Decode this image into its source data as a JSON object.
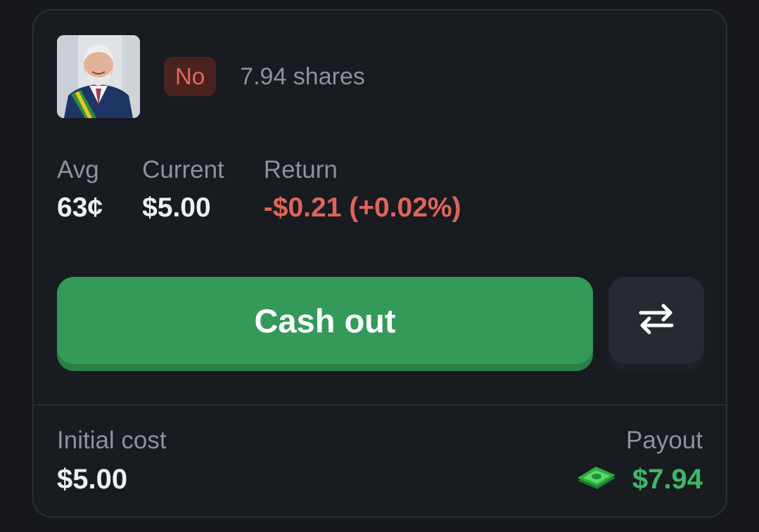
{
  "position": {
    "avatar_alt": "politician portrait",
    "side": "No",
    "shares": "7.94 shares"
  },
  "stats": {
    "avg_label": "Avg",
    "avg_value": "63¢",
    "current_label": "Current",
    "current_value": "$5.00",
    "return_label": "Return",
    "return_value": "-$0.21 (+0.02%)"
  },
  "actions": {
    "cashout_label": "Cash out",
    "swap_icon": "swap-arrows-icon"
  },
  "footer": {
    "initial_cost_label": "Initial cost",
    "initial_cost_value": "$5.00",
    "payout_label": "Payout",
    "payout_value": "$7.94",
    "payout_icon": "money-bill-icon"
  },
  "colors": {
    "background": "#181b1f",
    "badge_bg": "#4a231f",
    "badge_text": "#e8675b",
    "negative": "#e0645a",
    "cashout_green": "#349a5a",
    "payout_green": "#3fb766"
  }
}
